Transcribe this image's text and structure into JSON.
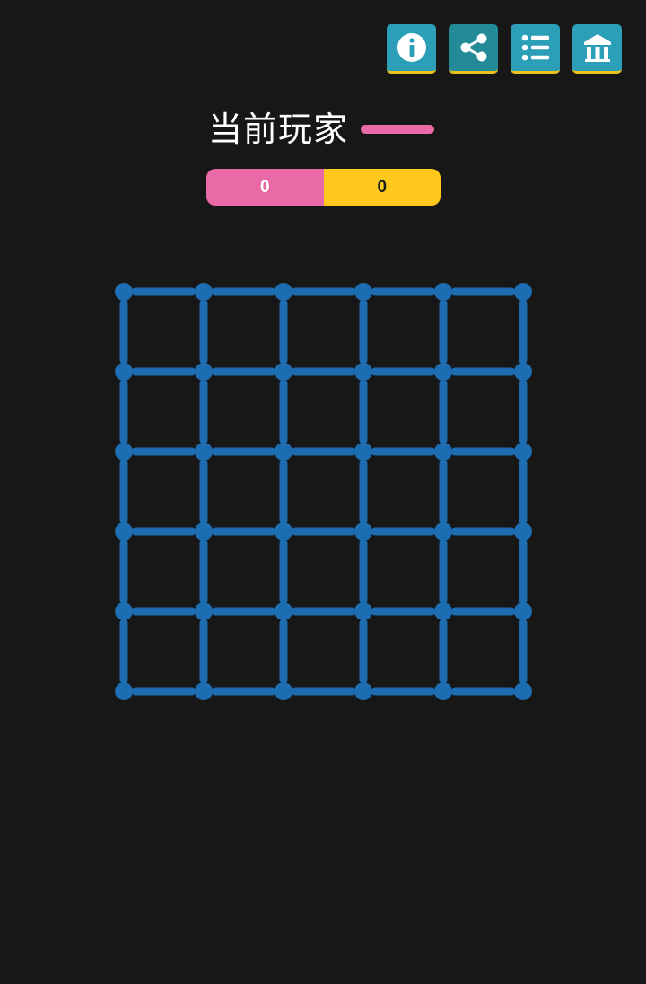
{
  "toolbar": {
    "buttons": [
      {
        "name": "info",
        "icon": "info-icon"
      },
      {
        "name": "share",
        "icon": "share-icon"
      },
      {
        "name": "menu",
        "icon": "list-icon"
      },
      {
        "name": "home",
        "icon": "home-icon"
      }
    ],
    "button_color": "#2b9fb7",
    "button_underline_color": "#e8c21a"
  },
  "current_player": {
    "label": "当前玩家",
    "color": "#e96aa7"
  },
  "scores": {
    "player1": {
      "value": "0",
      "color": "#e96aa7"
    },
    "player2": {
      "value": "0",
      "color": "#fec81c"
    }
  },
  "board": {
    "rows": 5,
    "cols": 5,
    "line_color": "#1c6db2",
    "dot_color": "#1c6db2"
  }
}
